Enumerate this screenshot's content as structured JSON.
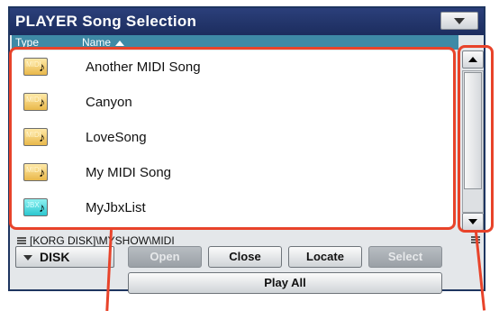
{
  "window": {
    "title": "PLAYER Song Selection"
  },
  "columns": {
    "type": "Type",
    "name": "Name"
  },
  "files": [
    {
      "name": "Another MIDI Song",
      "type_tag": "MIDI",
      "icon": "midi-file-icon"
    },
    {
      "name": "Canyon",
      "type_tag": "MIDI",
      "icon": "midi-file-icon"
    },
    {
      "name": "LoveSong",
      "type_tag": "MIDI",
      "icon": "midi-file-icon"
    },
    {
      "name": "My MIDI Song",
      "type_tag": "MIDI",
      "icon": "midi-file-icon"
    },
    {
      "name": "MyJbxList",
      "type_tag": "JBX",
      "icon": "jukebox-file-icon"
    }
  ],
  "path": "[KORG DISK]\\MYSHOW\\MIDI",
  "device": {
    "selected": "DISK"
  },
  "buttons": {
    "open": "Open",
    "close": "Close",
    "locate": "Locate",
    "select": "Select",
    "play_all": "Play All"
  },
  "colors": {
    "title_bar": "#1c2d5e",
    "header": "#3e8aa6",
    "midi_icon": "#e9b84a",
    "jbx_icon": "#2cc7d0",
    "callout": "#e8432a",
    "disabled_button": "#9aa0a6"
  }
}
